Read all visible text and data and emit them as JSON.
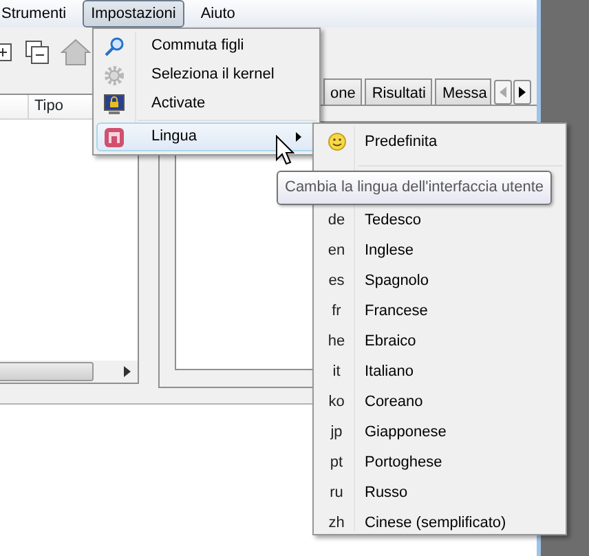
{
  "menubar": [
    {
      "label": "Strumenti",
      "selected": false
    },
    {
      "label": "Impostazioni",
      "selected": true
    },
    {
      "label": "Aiuto",
      "selected": false
    }
  ],
  "left_panel": {
    "columns": [
      "Tipo"
    ]
  },
  "tabs": [
    {
      "label": "one",
      "selected": false
    },
    {
      "label": "Risultati",
      "selected": false
    },
    {
      "label": "Messa",
      "selected": false
    }
  ],
  "menu": [
    {
      "kind": "search",
      "label": "Commuta figli",
      "selected": false,
      "submenu": false
    },
    {
      "kind": "gear",
      "label": "Seleziona il kernel",
      "selected": false,
      "submenu": false
    },
    {
      "kind": "monitor",
      "label": "Activate",
      "selected": false,
      "submenu": false
    },
    {
      "kind": "language",
      "label": "Lingua",
      "selected": true,
      "submenu": true
    }
  ],
  "submenu": {
    "default": {
      "label": "Predefinita"
    },
    "languages": [
      {
        "code": "de",
        "label": "Tedesco"
      },
      {
        "code": "en",
        "label": "Inglese"
      },
      {
        "code": "es",
        "label": "Spagnolo"
      },
      {
        "code": "fr",
        "label": "Francese"
      },
      {
        "code": "he",
        "label": "Ebraico"
      },
      {
        "code": "it",
        "label": "Italiano"
      },
      {
        "code": "ko",
        "label": "Coreano"
      },
      {
        "code": "jp",
        "label": "Giapponese"
      },
      {
        "code": "pt",
        "label": "Portoghese"
      },
      {
        "code": "ru",
        "label": "Russo"
      },
      {
        "code": "zh",
        "label": "Cinese (semplificato)"
      }
    ]
  },
  "tooltip": "Cambia la lingua dell'interfaccia utente"
}
